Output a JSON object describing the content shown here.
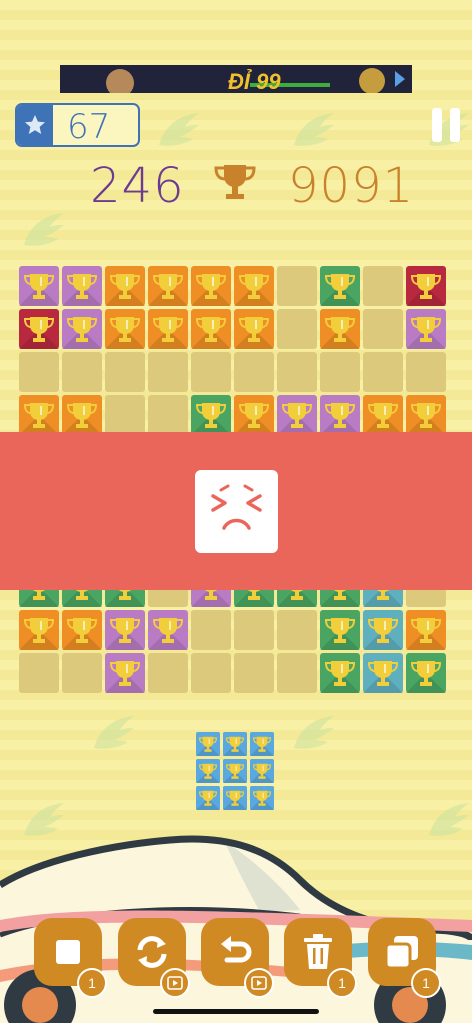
{
  "ad": {
    "text": "ĐỈ 99"
  },
  "level": {
    "value": "67"
  },
  "score": {
    "current": "246",
    "best": "9091"
  },
  "colors": {
    "purple": "#b97bc4",
    "orange": "#ee8e25",
    "green": "#4aa562",
    "red": "#b8283f",
    "blue": "#5fb0bf",
    "empty": "#ddc97b",
    "piece": "#59a8df",
    "banner": "#ea665a"
  },
  "board": {
    "rows": [
      [
        "purple",
        "purple",
        "orange",
        "orange",
        "orange",
        "orange",
        "empty",
        "green",
        "empty",
        "red"
      ],
      [
        "red",
        "purple",
        "orange",
        "orange",
        "orange",
        "orange",
        "empty",
        "orange",
        "empty",
        "purple"
      ],
      [
        "empty",
        "empty",
        "empty",
        "empty",
        "empty",
        "empty",
        "empty",
        "empty",
        "empty",
        "empty"
      ],
      [
        "orange",
        "orange",
        "empty",
        "empty",
        "green",
        "orange",
        "purple",
        "purple",
        "orange",
        "orange"
      ],
      [
        "empty",
        "empty",
        "empty",
        "empty",
        "empty",
        "empty",
        "empty",
        "empty",
        "empty",
        "empty"
      ],
      [
        "empty",
        "empty",
        "empty",
        "empty",
        "empty",
        "empty",
        "empty",
        "empty",
        "empty",
        "empty"
      ],
      [
        "empty",
        "empty",
        "empty",
        "empty",
        "empty",
        "empty",
        "empty",
        "empty",
        "empty",
        "empty"
      ],
      [
        "green",
        "green",
        "green",
        "empty",
        "purple",
        "green",
        "green",
        "green",
        "blue",
        "empty"
      ],
      [
        "orange",
        "orange",
        "purple",
        "purple",
        "empty",
        "empty",
        "empty",
        "green",
        "blue",
        "orange"
      ],
      [
        "empty",
        "empty",
        "purple",
        "empty",
        "empty",
        "empty",
        "empty",
        "green",
        "blue",
        "green"
      ]
    ]
  },
  "status": {
    "face": "frustrated-face"
  },
  "next_piece": {
    "shape": "3x3",
    "color": "piece"
  },
  "toolbar": [
    {
      "name": "single-block-tool",
      "icon": "square-icon",
      "badge": "1",
      "badge_type": "count"
    },
    {
      "name": "rotate-tool",
      "icon": "rotate-icon",
      "badge": "",
      "badge_type": "video"
    },
    {
      "name": "undo-tool",
      "icon": "undo-icon",
      "badge": "",
      "badge_type": "video"
    },
    {
      "name": "delete-tool",
      "icon": "trash-icon",
      "badge": "1",
      "badge_type": "count"
    },
    {
      "name": "swap-tool",
      "icon": "layers-icon",
      "badge": "1",
      "badge_type": "count"
    }
  ]
}
